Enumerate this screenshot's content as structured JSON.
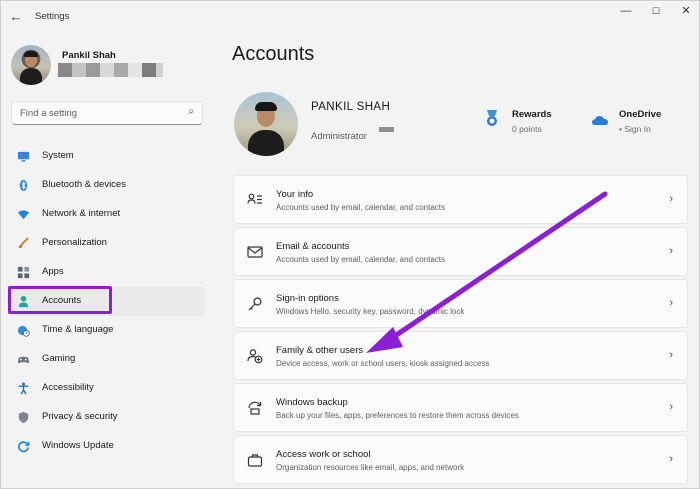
{
  "window": {
    "title": "Settings"
  },
  "profile": {
    "name": "Pankil Shah"
  },
  "search": {
    "placeholder": "Find a setting"
  },
  "sidebar": {
    "items": [
      {
        "label": "System",
        "icon": "monitor-icon",
        "active": false
      },
      {
        "label": "Bluetooth & devices",
        "icon": "bluetooth-icon",
        "active": false
      },
      {
        "label": "Network & internet",
        "icon": "wifi-icon",
        "active": false
      },
      {
        "label": "Personalization",
        "icon": "brush-icon",
        "active": false
      },
      {
        "label": "Apps",
        "icon": "apps-icon",
        "active": false
      },
      {
        "label": "Accounts",
        "icon": "person-icon",
        "active": true
      },
      {
        "label": "Time & language",
        "icon": "globe-clock-icon",
        "active": false
      },
      {
        "label": "Gaming",
        "icon": "controller-icon",
        "active": false
      },
      {
        "label": "Accessibility",
        "icon": "accessibility-icon",
        "active": false
      },
      {
        "label": "Privacy & security",
        "icon": "shield-icon",
        "active": false
      },
      {
        "label": "Windows Update",
        "icon": "update-icon",
        "active": false
      }
    ]
  },
  "main": {
    "title": "Accounts",
    "user": {
      "name": "PANKIL SHAH",
      "role": "Administrator"
    },
    "rewards": {
      "title": "Rewards",
      "subtitle": "0 points"
    },
    "onedrive": {
      "title": "OneDrive",
      "subtitle": "• Sign In"
    },
    "cards": [
      {
        "title": "Your info",
        "description": "Accounts used by email, calendar, and contacts",
        "icon": "person-list-icon"
      },
      {
        "title": "Email & accounts",
        "description": "Accounts used by email, calendar, and contacts",
        "icon": "mail-icon"
      },
      {
        "title": "Sign-in options",
        "description": "Windows Hello, security key, password, dynamic lock",
        "icon": "key-icon"
      },
      {
        "title": "Family & other users",
        "description": "Device access, work or school users, kiosk assigned access",
        "icon": "add-people-icon"
      },
      {
        "title": "Windows backup",
        "description": "Back up your files, apps, preferences to restore them across devices",
        "icon": "backup-icon"
      },
      {
        "title": "Access work or school",
        "description": "Organization resources like email, apps, and network",
        "icon": "briefcase-icon"
      }
    ]
  },
  "colors": {
    "highlight": "#8b1fd1",
    "accent": "#0067c0"
  }
}
